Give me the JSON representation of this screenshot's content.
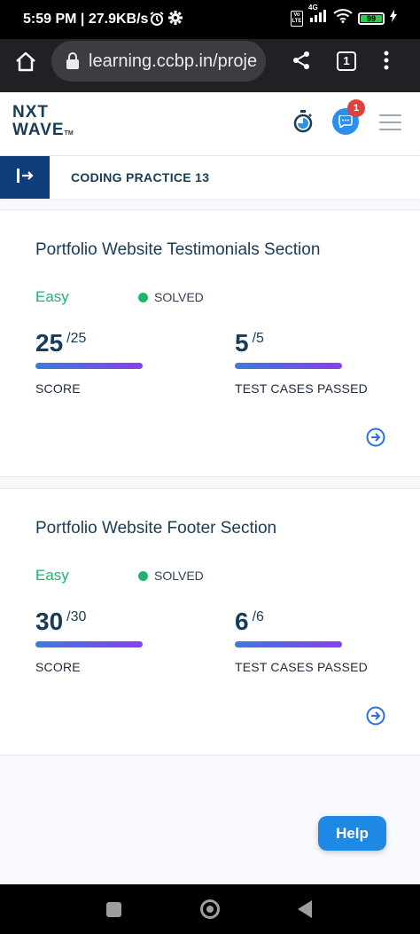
{
  "status_bar": {
    "time": "5:59 PM | 27.9KB/s",
    "network": "4G",
    "volte": "Vo LTE",
    "battery": "99"
  },
  "browser": {
    "url": "learning.ccbp.in/proje",
    "tab_count": "1"
  },
  "app_header": {
    "logo_line1": "NXT",
    "logo_line2": "WAVE",
    "logo_tm": "TM",
    "notification_count": "1"
  },
  "page": {
    "title": "CODING PRACTICE 13"
  },
  "cards": [
    {
      "title": "Portfolio Website Testimonials Section",
      "difficulty": "Easy",
      "status": "SOLVED",
      "score": "25",
      "score_total": "/25",
      "score_label": "SCORE",
      "tests_passed": "5",
      "tests_total": "/5",
      "tests_label": "TEST CASES PASSED",
      "score_progress": 1.0,
      "tests_progress": 1.0
    },
    {
      "title": "Portfolio Website Footer Section",
      "difficulty": "Easy",
      "status": "SOLVED",
      "score": "30",
      "score_total": "/30",
      "score_label": "SCORE",
      "tests_passed": "6",
      "tests_total": "/6",
      "tests_label": "TEST CASES PASSED",
      "score_progress": 1.0,
      "tests_progress": 1.0
    }
  ],
  "help_button": {
    "label": "Help"
  },
  "colors": {
    "brand_dark": "#183b56",
    "nav_blue": "#103e7c",
    "easy_green": "#23b26d",
    "help_blue": "#1e88e5",
    "progress_start": "#3a7bdc",
    "progress_end": "#8a3ff0"
  },
  "icons": {
    "alarm": "alarm-icon",
    "settings": "gear-icon",
    "home": "home-icon",
    "lock": "lock-icon",
    "share": "share-icon",
    "menu": "more-vert-icon",
    "timer": "stopwatch-icon",
    "chat": "chat-icon",
    "hamburger": "hamburger-icon",
    "collapse": "sidebar-expand-icon",
    "go": "arrow-circle-right-icon"
  }
}
